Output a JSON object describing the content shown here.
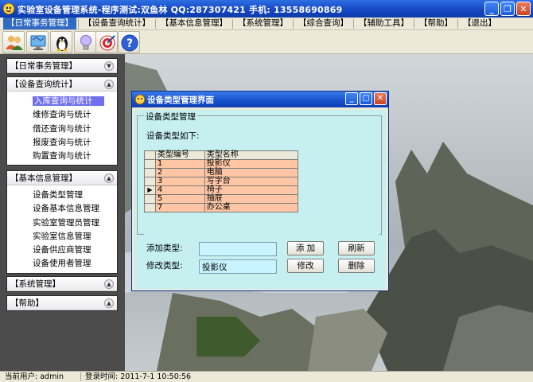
{
  "app": {
    "title": "实验室设备管理系统-程序测试:双鱼林  QQ:287307421  手机: 13558690869"
  },
  "menu": [
    {
      "label": "【日常事务管理】",
      "active": true
    },
    {
      "label": "【设备查询统计】"
    },
    {
      "label": "【基本信息管理】"
    },
    {
      "label": "【系统管理】"
    },
    {
      "label": "【综合查询】"
    },
    {
      "label": "【辅助工具】"
    },
    {
      "label": "【帮助】"
    },
    {
      "label": "【退出】"
    }
  ],
  "toolbar": {
    "icons": [
      "users-icon",
      "network-computer-icon",
      "linux-penguin-icon",
      "lightbulb-icon",
      "target-icon",
      "help-icon"
    ]
  },
  "sidebar": {
    "groups": [
      {
        "title": "【日常事务管理】",
        "expanded": false,
        "items": []
      },
      {
        "title": "【设备查询统计】",
        "expanded": true,
        "items": [
          "入库查询与统计",
          "维修查询与统计",
          "借还查询与统计",
          "报废查询与统计",
          "购置查询与统计"
        ],
        "selected": 0
      },
      {
        "title": "【基本信息管理】",
        "expanded": true,
        "items": [
          "设备类型管理",
          "设备基本信息管理",
          "实验室管理员管理",
          "实验室信息管理",
          "设备供应商管理",
          "设备使用者管理"
        ]
      },
      {
        "title": "【系统管理】",
        "expanded": false,
        "items": []
      },
      {
        "title": "【帮助】",
        "expanded": false,
        "items": []
      }
    ]
  },
  "dialog": {
    "title": "设备类型管理界面",
    "group_title": "设备类型管理",
    "section_label": "设备类型如下:",
    "columns": [
      "类型编号",
      "类型名称"
    ],
    "rows": [
      {
        "id": "1",
        "name": "投影仪"
      },
      {
        "id": "2",
        "name": "电脑"
      },
      {
        "id": "3",
        "name": "写字台"
      },
      {
        "id": "4",
        "name": "椅子",
        "current": true
      },
      {
        "id": "5",
        "name": "抽屉"
      },
      {
        "id": "7",
        "name": "办公桌"
      }
    ],
    "add_label": "添加类型:",
    "add_value": "",
    "edit_label": "修改类型:",
    "edit_value": "投影仪",
    "btn_add": "添  加",
    "btn_refresh": "刷新",
    "btn_edit": "修改",
    "btn_delete": "删除"
  },
  "status": {
    "user": "当前用户: admin",
    "login_time": "登录时间: 2011-7-1  10:50:56"
  },
  "colors": {
    "titlebar": "#1648c6",
    "sidebar_bg": "#4c4c4c",
    "dialog_body": "#c6f0f0",
    "grid_row": "#ffc6a6",
    "selected_item": "#7070ee"
  }
}
